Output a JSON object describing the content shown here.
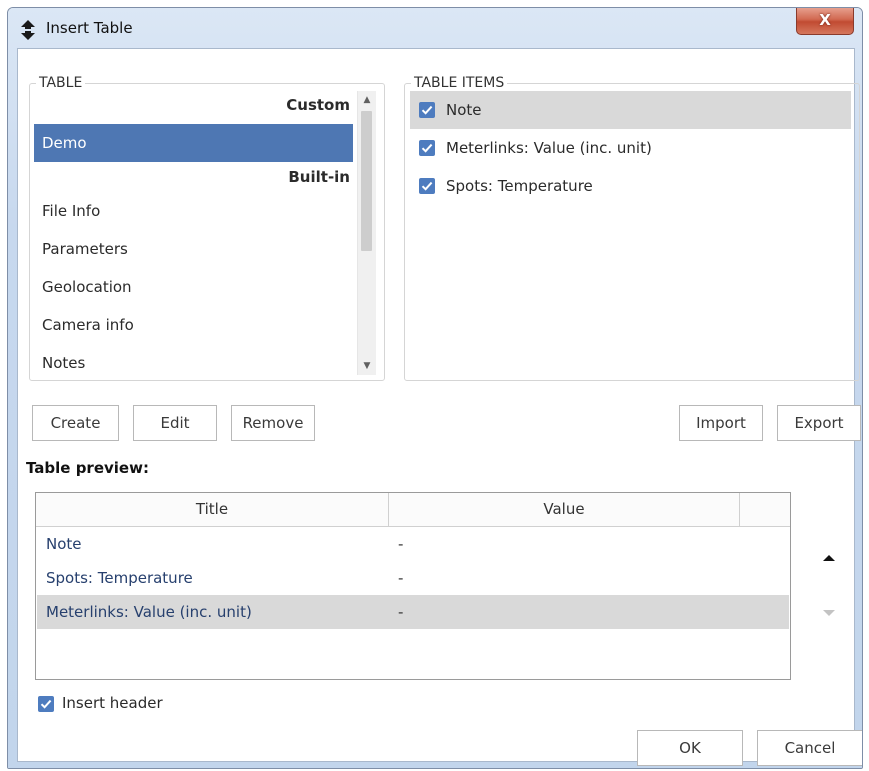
{
  "window": {
    "title": "Insert Table",
    "close_label": "X"
  },
  "table_group": {
    "label": "TABLE",
    "rows": [
      {
        "label": "Custom",
        "kind": "header"
      },
      {
        "label": "Demo",
        "kind": "selected"
      },
      {
        "label": "Built-in",
        "kind": "header"
      },
      {
        "label": "File Info",
        "kind": "item"
      },
      {
        "label": "Parameters",
        "kind": "item"
      },
      {
        "label": "Geolocation",
        "kind": "item"
      },
      {
        "label": "Camera info",
        "kind": "item"
      },
      {
        "label": "Notes",
        "kind": "item"
      }
    ]
  },
  "items_group": {
    "label": "TABLE ITEMS",
    "items": [
      {
        "label": "Note",
        "checked": true
      },
      {
        "label": "Meterlinks: Value (inc. unit)",
        "checked": true
      },
      {
        "label": "Spots: Temperature",
        "checked": true
      }
    ]
  },
  "buttons": {
    "create": "Create",
    "edit": "Edit",
    "remove": "Remove",
    "import": "Import",
    "export": "Export",
    "ok": "OK",
    "cancel": "Cancel"
  },
  "preview": {
    "heading": "Table preview:",
    "columns": [
      "Title",
      "Value"
    ],
    "rows": [
      {
        "title": "Note",
        "value": "-"
      },
      {
        "title": "Spots: Temperature",
        "value": "-"
      },
      {
        "title": "Meterlinks: Value (inc. unit)",
        "value": "-"
      }
    ]
  },
  "insert_header": {
    "label": "Insert header",
    "checked": true
  },
  "colors": {
    "selection": "#4e77b3",
    "checkbox": "#4e7cbf",
    "highlight": "#d9d9d9"
  }
}
